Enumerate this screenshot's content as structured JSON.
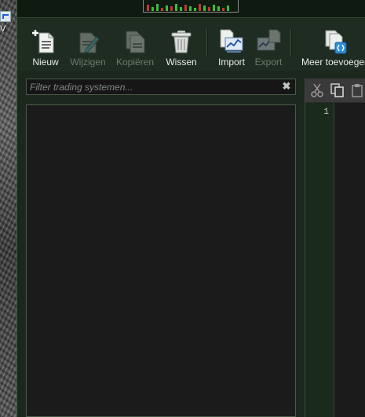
{
  "desktop": {
    "shortcut_label": "V"
  },
  "toolbar": {
    "buttons": [
      {
        "label": "Nieuw",
        "enabled": true
      },
      {
        "label": "Wijzigen",
        "enabled": false
      },
      {
        "label": "Kopiëren",
        "enabled": false
      },
      {
        "label": "Wissen",
        "enabled": true
      },
      {
        "label": "Import",
        "enabled": true
      },
      {
        "label": "Export",
        "enabled": false
      },
      {
        "label": "Meer toevoegen",
        "enabled": true
      }
    ]
  },
  "filter": {
    "placeholder": "Filter trading systemen...",
    "value": "",
    "clear_glyph": "✖"
  },
  "editor": {
    "line_numbers": [
      "1"
    ]
  },
  "colors": {
    "background": "#1d2a1f",
    "accent_green": "#3bbf3b",
    "accent_red": "#c33",
    "text_enabled": "#e9efe9",
    "text_disabled": "#6d7a6e"
  },
  "icons": [
    "new-document-icon",
    "edit-document-icon",
    "copy-document-icon",
    "trash-icon",
    "import-chart-icon",
    "export-chart-icon",
    "add-more-icon",
    "cut-icon",
    "copy-icon",
    "paste-icon",
    "clear-filter-icon"
  ]
}
